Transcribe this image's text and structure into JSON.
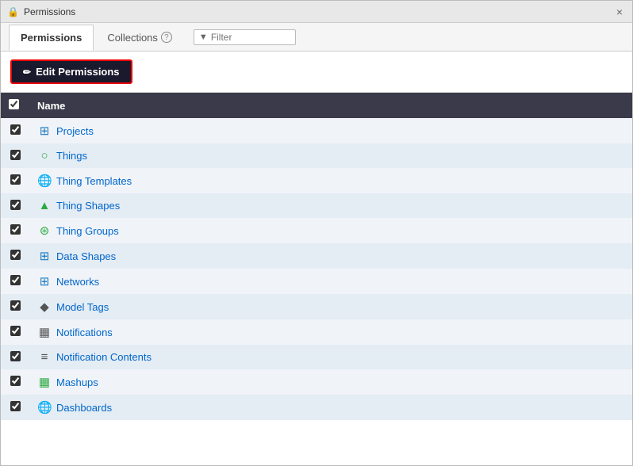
{
  "window": {
    "title": "Permissions",
    "close_label": "×"
  },
  "tabs": {
    "permissions_label": "Permissions",
    "collections_label": "Collections",
    "help_icon": "?",
    "filter_placeholder": "Filter",
    "filter_icon": "▼"
  },
  "toolbar": {
    "edit_permissions_label": "Edit Permissions",
    "edit_icon": "✏"
  },
  "table": {
    "header_name": "Name",
    "rows": [
      {
        "name": "Projects",
        "icon": "🏗",
        "icon_class": "icon-projects",
        "checked": true
      },
      {
        "name": "Things",
        "icon": "○",
        "icon_class": "icon-things",
        "checked": true
      },
      {
        "name": "Thing Templates",
        "icon": "🌐",
        "icon_class": "icon-thing-templates",
        "checked": true
      },
      {
        "name": "Thing Shapes",
        "icon": "🗺",
        "icon_class": "icon-thing-shapes",
        "checked": true
      },
      {
        "name": "Thing Groups",
        "icon": "👥",
        "icon_class": "icon-thing-groups",
        "checked": true
      },
      {
        "name": "Data Shapes",
        "icon": "⊞",
        "icon_class": "icon-data-shapes",
        "checked": true
      },
      {
        "name": "Networks",
        "icon": "⊞",
        "icon_class": "icon-networks",
        "checked": true
      },
      {
        "name": "Model Tags",
        "icon": "🏷",
        "icon_class": "icon-model-tags",
        "checked": true
      },
      {
        "name": "Notifications",
        "icon": "💬",
        "icon_class": "icon-notifications",
        "checked": true
      },
      {
        "name": "Notification Contents",
        "icon": "☰",
        "icon_class": "icon-notification-contents",
        "checked": true
      },
      {
        "name": "Mashups",
        "icon": "▦",
        "icon_class": "icon-mashups",
        "checked": true
      },
      {
        "name": "Dashboards",
        "icon": "🌐",
        "icon_class": "icon-dashboards",
        "checked": true
      }
    ]
  }
}
